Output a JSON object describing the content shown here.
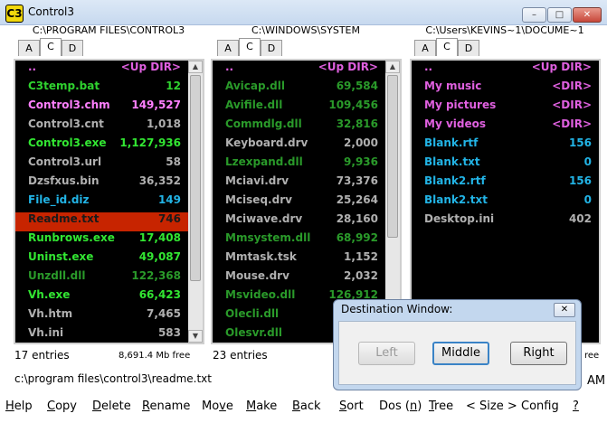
{
  "window": {
    "title": "Control3",
    "app_icon_text": "C3",
    "minimize_glyph": "–",
    "maximize_glyph": "□",
    "close_glyph": "✕"
  },
  "panels": [
    {
      "path": "C:\\PROGRAM FILES\\CONTROL3",
      "tabs": [
        "A",
        "C",
        "D"
      ],
      "active_tab": "C",
      "status": "17 entries",
      "free": "8,691.4 Mb free",
      "rows": [
        {
          "name": "..",
          "value": "<Up DIR>",
          "color": "#e060e0",
          "highlight": false
        },
        {
          "name": "C3temp.bat",
          "value": "12",
          "color": "#2fd22f",
          "highlight": false
        },
        {
          "name": "Control3.chm",
          "value": "149,527",
          "color": "#ff80ff",
          "highlight": false
        },
        {
          "name": "Control3.cnt",
          "value": "1,018",
          "color": "#b0b0b0",
          "highlight": false
        },
        {
          "name": "Control3.exe",
          "value": "1,127,936",
          "color": "#32e632",
          "highlight": false
        },
        {
          "name": "Control3.url",
          "value": "58",
          "color": "#b0b0b0",
          "highlight": false
        },
        {
          "name": "Dzsfxus.bin",
          "value": "36,352",
          "color": "#b0b0b0",
          "highlight": false
        },
        {
          "name": "File_id.diz",
          "value": "149",
          "color": "#22b4e6",
          "highlight": false
        },
        {
          "name": "Readme.txt",
          "value": "746",
          "color": "#1a1a1a",
          "highlight": true
        },
        {
          "name": "Runbrows.exe",
          "value": "17,408",
          "color": "#32e632",
          "highlight": false
        },
        {
          "name": "Uninst.exe",
          "value": "49,087",
          "color": "#32e632",
          "highlight": false
        },
        {
          "name": "Unzdll.dll",
          "value": "122,368",
          "color": "#2a9a2a",
          "highlight": false
        },
        {
          "name": "Vh.exe",
          "value": "66,423",
          "color": "#32e632",
          "highlight": false
        },
        {
          "name": "Vh.htm",
          "value": "7,465",
          "color": "#b0b0b0",
          "highlight": false
        },
        {
          "name": "Vh.ini",
          "value": "583",
          "color": "#b0b0b0",
          "highlight": false
        }
      ]
    },
    {
      "path": "C:\\WINDOWS\\SYSTEM",
      "tabs": [
        "A",
        "C",
        "D"
      ],
      "active_tab": "C",
      "status": "23 entries",
      "free": "",
      "rows": [
        {
          "name": "..",
          "value": "<Up DIR>",
          "color": "#e060e0",
          "highlight": false
        },
        {
          "name": "Avicap.dll",
          "value": "69,584",
          "color": "#2a9a2a",
          "highlight": false
        },
        {
          "name": "Avifile.dll",
          "value": "109,456",
          "color": "#2a9a2a",
          "highlight": false
        },
        {
          "name": "Commdlg.dll",
          "value": "32,816",
          "color": "#2a9a2a",
          "highlight": false
        },
        {
          "name": "Keyboard.drv",
          "value": "2,000",
          "color": "#b0b0b0",
          "highlight": false
        },
        {
          "name": "Lzexpand.dll",
          "value": "9,936",
          "color": "#2a9a2a",
          "highlight": false
        },
        {
          "name": "Mciavi.drv",
          "value": "73,376",
          "color": "#b0b0b0",
          "highlight": false
        },
        {
          "name": "Mciseq.drv",
          "value": "25,264",
          "color": "#b0b0b0",
          "highlight": false
        },
        {
          "name": "Mciwave.drv",
          "value": "28,160",
          "color": "#b0b0b0",
          "highlight": false
        },
        {
          "name": "Mmsystem.dll",
          "value": "68,992",
          "color": "#2a9a2a",
          "highlight": false
        },
        {
          "name": "Mmtask.tsk",
          "value": "1,152",
          "color": "#b0b0b0",
          "highlight": false
        },
        {
          "name": "Mouse.drv",
          "value": "2,032",
          "color": "#b0b0b0",
          "highlight": false
        },
        {
          "name": "Msvideo.dll",
          "value": "126,912",
          "color": "#2a9a2a",
          "highlight": false
        },
        {
          "name": "Olecli.dll",
          "value": "",
          "color": "#2a9a2a",
          "highlight": false
        },
        {
          "name": "Olesvr.dll",
          "value": "",
          "color": "#2a9a2a",
          "highlight": false
        }
      ]
    },
    {
      "path": "C:\\Users\\KEVINS~1\\DOCUME~1",
      "tabs": [
        "A",
        "C",
        "D"
      ],
      "active_tab": "C",
      "status": "",
      "free": "ree",
      "rows": [
        {
          "name": "..",
          "value": "<Up DIR>",
          "color": "#e060e0",
          "highlight": false
        },
        {
          "name": "My music",
          "value": "<DIR>",
          "color": "#e060e0",
          "highlight": false
        },
        {
          "name": "My pictures",
          "value": "<DIR>",
          "color": "#e060e0",
          "highlight": false
        },
        {
          "name": "My videos",
          "value": "<DIR>",
          "color": "#e060e0",
          "highlight": false
        },
        {
          "name": "Blank.rtf",
          "value": "156",
          "color": "#22b4e6",
          "highlight": false
        },
        {
          "name": "Blank.txt",
          "value": "0",
          "color": "#22b4e6",
          "highlight": false
        },
        {
          "name": "Blank2.rtf",
          "value": "156",
          "color": "#22b4e6",
          "highlight": false
        },
        {
          "name": "Blank2.txt",
          "value": "0",
          "color": "#22b4e6",
          "highlight": false
        },
        {
          "name": "Desktop.ini",
          "value": "402",
          "color": "#b0b0b0",
          "highlight": false
        }
      ]
    }
  ],
  "current_path": "c:\\program files\\control3\\readme.txt",
  "clock_suffix": "AM",
  "menu": [
    {
      "label": "Help",
      "u": "H"
    },
    {
      "label": "Copy",
      "u": "C"
    },
    {
      "label": "Delete",
      "u": "D"
    },
    {
      "label": "Rename",
      "u": "R"
    },
    {
      "label": "Move",
      "u": "v"
    },
    {
      "label": "Make",
      "u": "M"
    },
    {
      "label": "Back",
      "u": "B"
    },
    {
      "label": "Sort",
      "u": "S"
    },
    {
      "label": "Dos (n)",
      "u": "n"
    },
    {
      "label": "Tree",
      "u": "T"
    },
    {
      "label": "< Size >",
      "u": ""
    },
    {
      "label": "Config",
      "u": ""
    },
    {
      "label": "?",
      "u": "?"
    }
  ],
  "dialog": {
    "title": "Destination Window:",
    "close_glyph": "✕",
    "buttons": [
      {
        "label": "Left",
        "enabled": false,
        "default": false
      },
      {
        "label": "Middle",
        "enabled": true,
        "default": true
      },
      {
        "label": "Right",
        "enabled": true,
        "default": false
      }
    ]
  },
  "colors": {
    "highlight_row": "#c72400",
    "panel_bg": "#000000",
    "dialog_frame": "#c3d7ee"
  }
}
